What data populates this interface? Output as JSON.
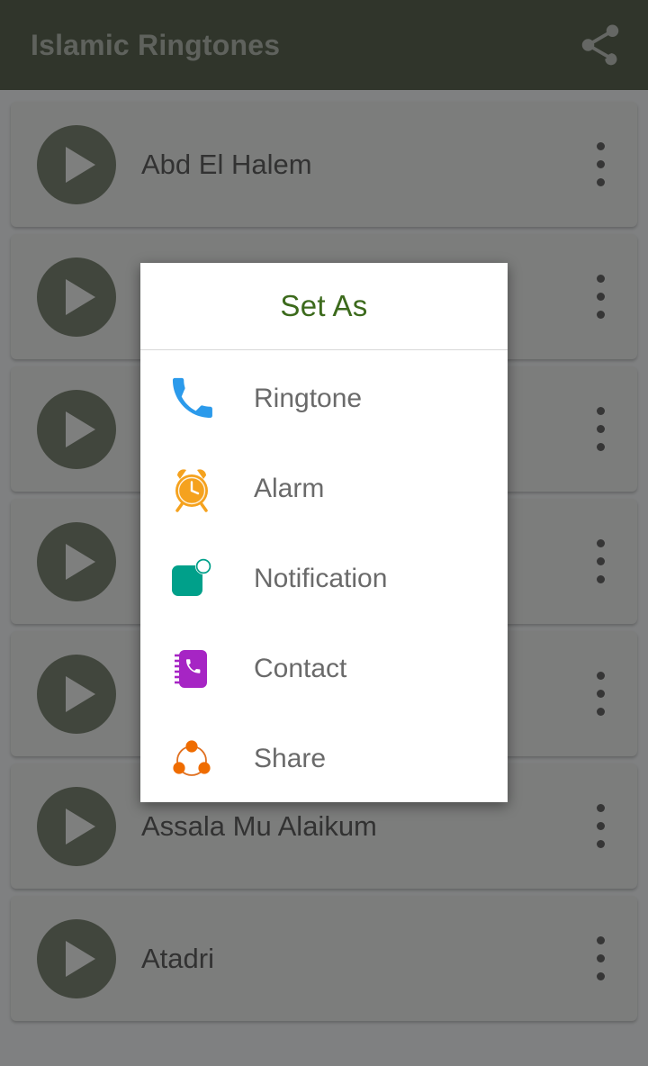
{
  "toolbar": {
    "title": "Islamic Ringtones",
    "share_icon": "share-icon"
  },
  "list": {
    "items": [
      {
        "title": "Abd El Halem",
        "play_icon": "play-icon",
        "menu_icon": "overflow-menu-icon"
      },
      {
        "title": "",
        "play_icon": "play-icon",
        "menu_icon": "overflow-menu-icon"
      },
      {
        "title": "",
        "play_icon": "play-icon",
        "menu_icon": "overflow-menu-icon"
      },
      {
        "title": "",
        "play_icon": "play-icon",
        "menu_icon": "overflow-menu-icon"
      },
      {
        "title": "",
        "play_icon": "play-icon",
        "menu_icon": "overflow-menu-icon"
      },
      {
        "title": "Assala Mu Alaikum",
        "play_icon": "play-icon",
        "menu_icon": "overflow-menu-icon"
      },
      {
        "title": "Atadri",
        "play_icon": "play-icon",
        "menu_icon": "overflow-menu-icon"
      }
    ]
  },
  "dialog": {
    "title": "Set As",
    "options": [
      {
        "label": "Ringtone",
        "icon": "phone-handset-icon",
        "color": "#2b9aeb"
      },
      {
        "label": "Alarm",
        "icon": "alarm-clock-icon",
        "color": "#f5a21e"
      },
      {
        "label": "Notification",
        "icon": "notification-icon",
        "color": "#00a08a"
      },
      {
        "label": "Contact",
        "icon": "contact-book-icon",
        "color": "#a625c4"
      },
      {
        "label": "Share",
        "icon": "share-nodes-icon",
        "color": "#ef6c00"
      }
    ]
  },
  "colors": {
    "toolbar_bg": "#1d2b12",
    "toolbar_text": "#9aa093",
    "dialog_title": "#3c6a1c",
    "option_label": "#6a6a6a",
    "card_bg": "#e4e7e4",
    "play_button": "#4b5741",
    "scrim": "rgba(60,60,60,0.62)"
  }
}
